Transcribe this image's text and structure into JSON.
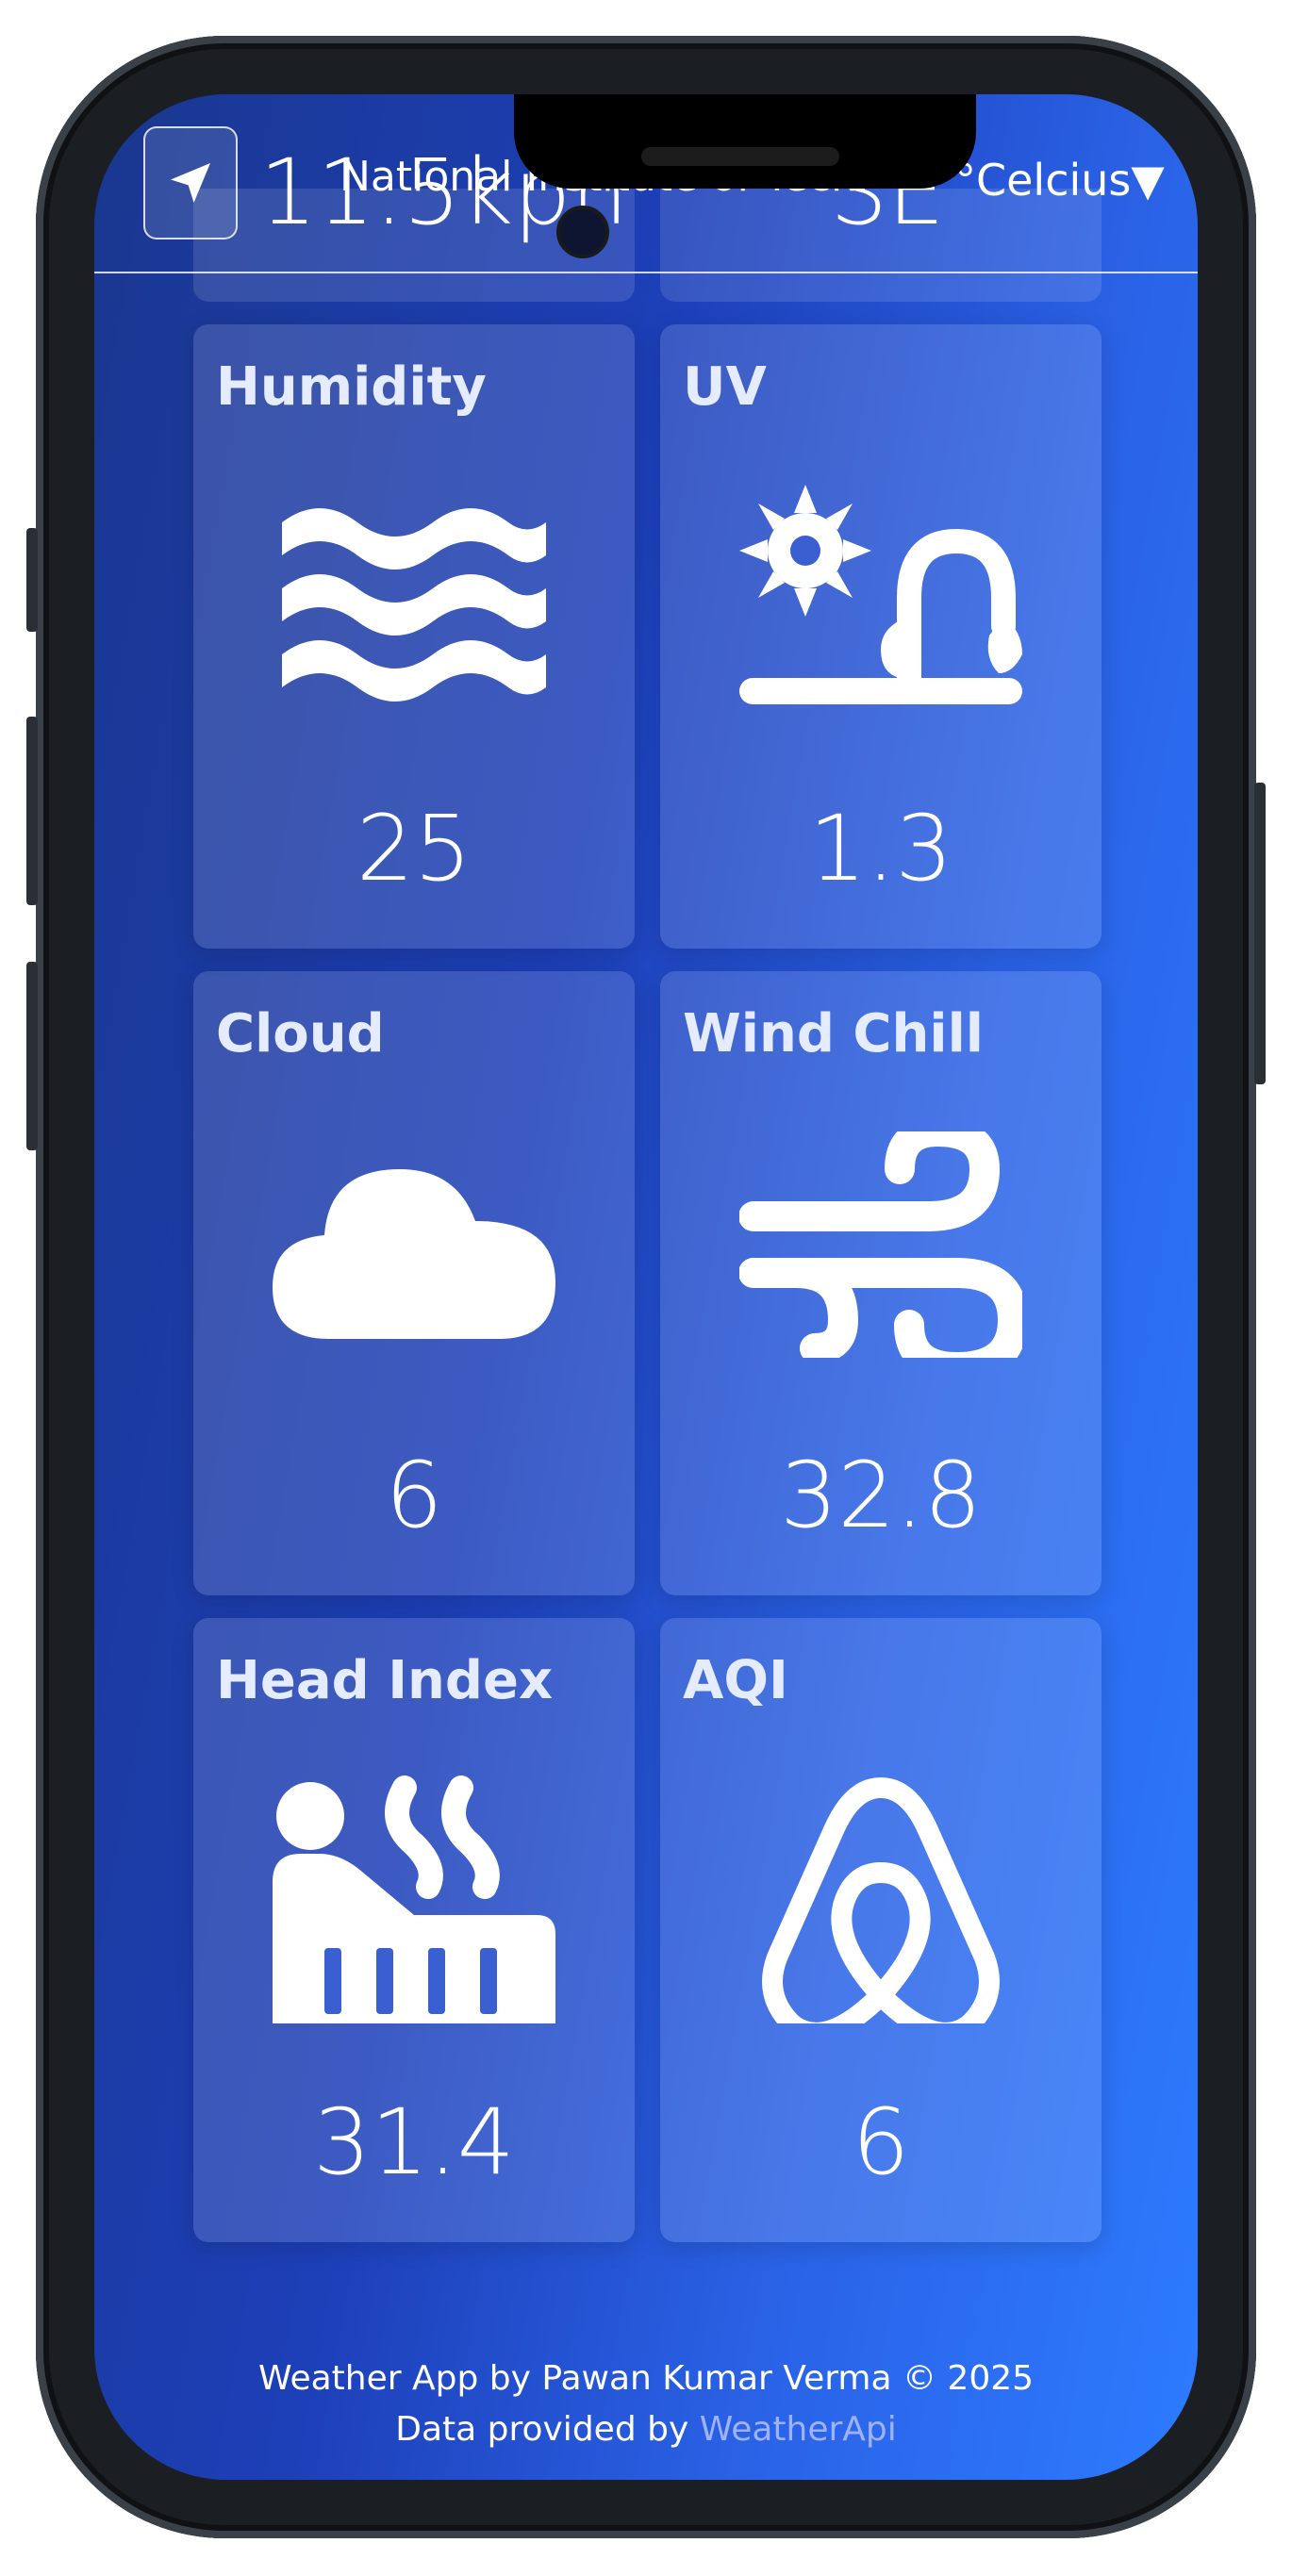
{
  "header": {
    "location_name": "National Institute of Techr",
    "wind_speed": "11.5kph",
    "wind_direction": "SE",
    "unit_select": "°Celcius▼"
  },
  "cards": [
    {
      "title": "Humidity",
      "value": "25",
      "icon": "waves-icon"
    },
    {
      "title": "UV",
      "value": "1.3",
      "icon": "sun-plant-icon"
    },
    {
      "title": "Cloud",
      "value": "6",
      "icon": "cloud-icon"
    },
    {
      "title": "Wind Chill",
      "value": "32.8",
      "icon": "wind-icon"
    },
    {
      "title": "Head Index",
      "value": "31.4",
      "icon": "factory-heat-icon"
    },
    {
      "title": "AQI",
      "value": "6",
      "icon": "airbnb-icon"
    }
  ],
  "footer": {
    "line1": "Weather App by Pawan Kumar Verma © 2025",
    "line2_prefix": "Data provided by ",
    "line2_link": "WeatherApi"
  },
  "colors": {
    "gradient_start": "#1a378f",
    "gradient_end": "#2d7bff",
    "link": "#9fb2ff"
  }
}
